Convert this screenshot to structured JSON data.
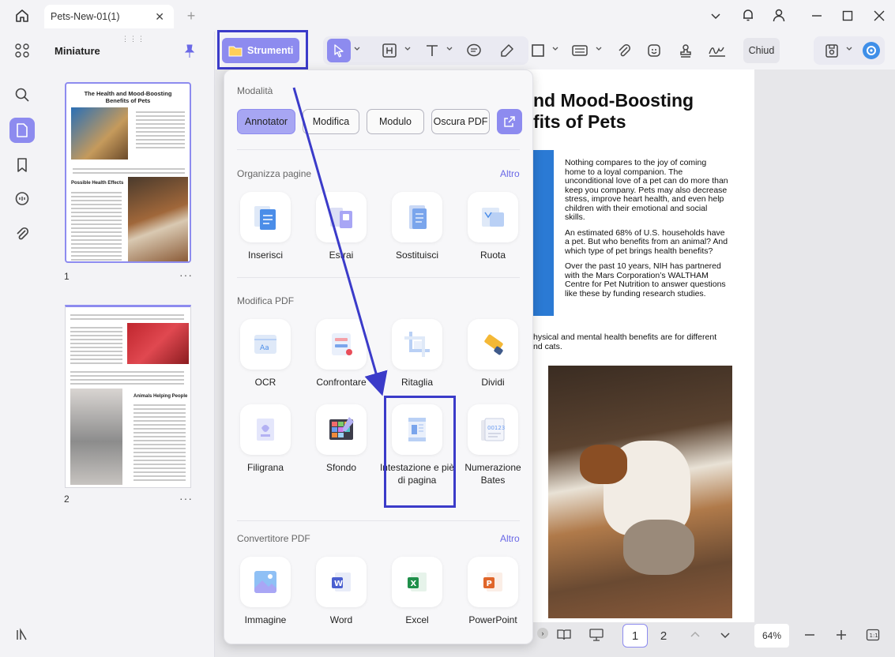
{
  "window": {
    "tab_title": "Pets-New-01(1)"
  },
  "sidebar": {
    "panel_title": "Miniature",
    "pages": [
      {
        "number": "1"
      },
      {
        "number": "2"
      }
    ]
  },
  "toolbar": {
    "strumenti_label": "Strumenti",
    "chiudi_label": "Chiud"
  },
  "tools_panel": {
    "modes_title": "Modalità",
    "modes": [
      "Annotator",
      "Modifica",
      "Modulo",
      "Oscura PDF"
    ],
    "organize_title": "Organizza pagine",
    "organize_more": "Altro",
    "organize": [
      "Inserisci",
      "Estrai",
      "Sostituisci",
      "Ruota"
    ],
    "edit_title": "Modifica PDF",
    "edit_row1": [
      "OCR",
      "Confrontare",
      "Ritaglia",
      "Dividi"
    ],
    "edit_row2": [
      "Filigrana",
      "Sfondo",
      "Intestazione e piè di pagina",
      "Numerazione Bates"
    ],
    "convert_title": "Convertitore PDF",
    "convert_more": "Altro",
    "convert": [
      "Immagine",
      "Word",
      "Excel",
      "PowerPoint"
    ]
  },
  "document": {
    "title_line1": "nd Mood-Boosting",
    "title_line2": "fits of Pets",
    "para1": "Nothing compares to the joy of coming home to a loyal companion. The unconditional love of a pet can do more than keep you company. Pets may also decrease stress, improve heart health,  and  even  help children  with  their emotional and social skills.",
    "para2": "An estimated 68% of U.S. households have a pet. But who benefits from an animal? And which type of pet brings health benefits?",
    "para3": "Over  the  past  10  years,  NIH  has partnered with the Mars Corporation’s WALTHAM Centre for  Pet  Nutrition  to answer  questions  like these by funding research studies.",
    "para4_line1": "hysical and mental health benefits are for different",
    "para4_line2": "nd cats."
  },
  "thumb1": {
    "title": "The Health and Mood-Boosting Benefits of Pets",
    "heading": "Possible Health Effects"
  },
  "thumb2": {
    "heading": "Animals Helping People"
  },
  "bottombar": {
    "page1": "1",
    "page2": "2",
    "zoom": "64%"
  },
  "colors": {
    "accent": "#8d8bef",
    "highlight": "#3b3bc9"
  }
}
